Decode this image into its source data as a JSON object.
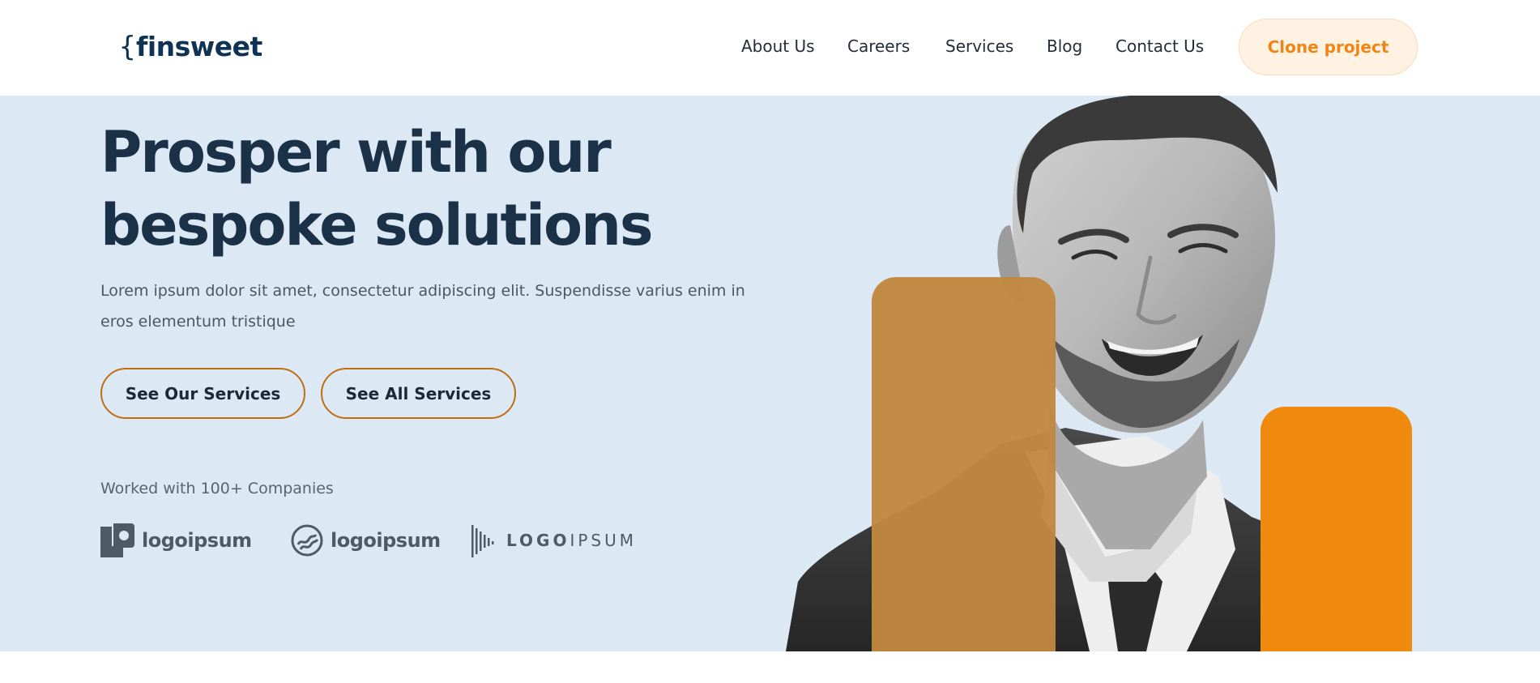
{
  "brand": {
    "logo_brace": "{",
    "logo_text": "finsweet"
  },
  "nav": {
    "links": [
      "About Us",
      "Careers",
      "Services",
      "Blog",
      "Contact Us"
    ],
    "cta_label": "Clone project"
  },
  "hero": {
    "headline_line1": "Prosper with our",
    "headline_line2": "bespoke solutions",
    "subtitle": "Lorem ipsum dolor sit amet, consectetur adipiscing elit. Suspendisse varius enim in eros elementum tristique",
    "buttons": [
      "See Our Services",
      "See All Services"
    ],
    "worked_with": "Worked with 100+ Companies",
    "partner_logos": [
      {
        "name": "logoipsum",
        "icon": "square-pin-logo-icon"
      },
      {
        "name": "logoipsum",
        "icon": "wave-circle-logo-icon"
      },
      {
        "name_bold": "LOGO",
        "name_light": "IPSUM",
        "icon": "bars-logo-icon"
      }
    ]
  },
  "colors": {
    "hero_bg": "#dce9f5",
    "navy": "#1b3147",
    "accent_orange": "#f08a0f",
    "accent_ochre": "#c1873f",
    "cta_bg": "#fff2e3"
  }
}
